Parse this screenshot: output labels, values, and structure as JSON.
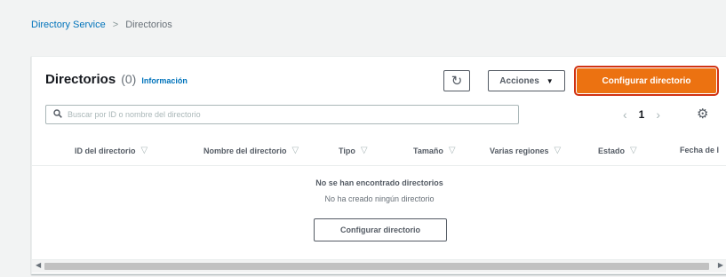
{
  "breadcrumb": {
    "root": "Directory Service",
    "separator": ">",
    "current": "Directorios"
  },
  "panel": {
    "title": "Directorios",
    "count": "(0)",
    "info_link": "Información"
  },
  "toolbar": {
    "refresh_icon": "↻",
    "actions_label": "Acciones",
    "actions_caret": "▼",
    "primary_label": "Configurar directorio"
  },
  "search": {
    "placeholder": "Buscar por ID o nombre del directorio",
    "value": ""
  },
  "pagination": {
    "prev": "‹",
    "page": "1",
    "next": "›",
    "settings_icon": "⚙"
  },
  "table": {
    "sort_icon": "▽",
    "columns": [
      "ID del directorio",
      "Nombre del directorio",
      "Tipo",
      "Tamaño",
      "Varias regiones",
      "Estado",
      "Fecha de l"
    ]
  },
  "empty_state": {
    "title": "No se han encontrado directorios",
    "subtitle": "No ha creado ningún directorio",
    "button_label": "Configurar directorio"
  },
  "scrollbar": {
    "left": "◀",
    "right": "▶"
  },
  "colors": {
    "primary": "#ec7211",
    "link": "#0073bb",
    "highlight_outline": "#d13212"
  }
}
